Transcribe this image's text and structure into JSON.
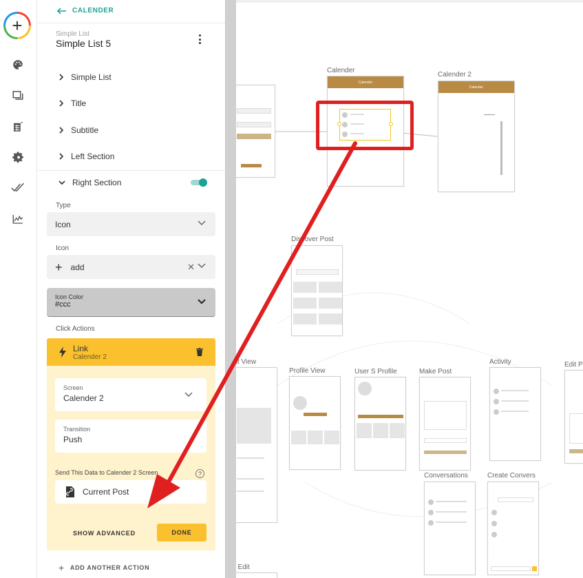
{
  "rail": {
    "icons": [
      "add-icon",
      "palette-icon",
      "screens-icon",
      "data-icon",
      "settings-icon",
      "publish-icon",
      "analytics-icon"
    ]
  },
  "panel": {
    "back_label": "CALENDER",
    "breadcrumb": "Simple List",
    "title": "Simple List 5",
    "tree": [
      "Simple List",
      "Title",
      "Subtitle",
      "Left Section",
      "Right Section"
    ],
    "type_label": "Type",
    "type_value": "Icon",
    "icon_label": "Icon",
    "icon_value": "add",
    "icon_color_label": "Icon Color",
    "icon_color_value": "#ccc",
    "click_actions_label": "Click Actions",
    "action": {
      "title": "Link",
      "subtitle": "Calender 2",
      "screen_label": "Screen",
      "screen_value": "Calender 2",
      "transition_label": "Transition",
      "transition_value": "Push",
      "send_label": "Send This Data to Calender 2 Screen",
      "data_value": "Current Post",
      "show_advanced": "SHOW ADVANCED",
      "done": "DONE"
    },
    "add_another": "ADD ANOTHER ACTION"
  },
  "canvas": {
    "screens": [
      "Calender",
      "Calender 2",
      "Discover Post",
      "st View",
      "Profile View",
      "User S Profile",
      "Make Post",
      "Activity",
      "Edit P",
      "Conversations",
      "Create Convers",
      "t Edit"
    ],
    "calender_header": "Calender",
    "calender2_header": "Calender",
    "accent": "#b88a43",
    "highlight": "#e02020",
    "selection": "#f5c518"
  },
  "colors": {
    "teal": "#1aa394",
    "yellow": "#fbc02d",
    "light_yellow": "#fff3cd"
  }
}
